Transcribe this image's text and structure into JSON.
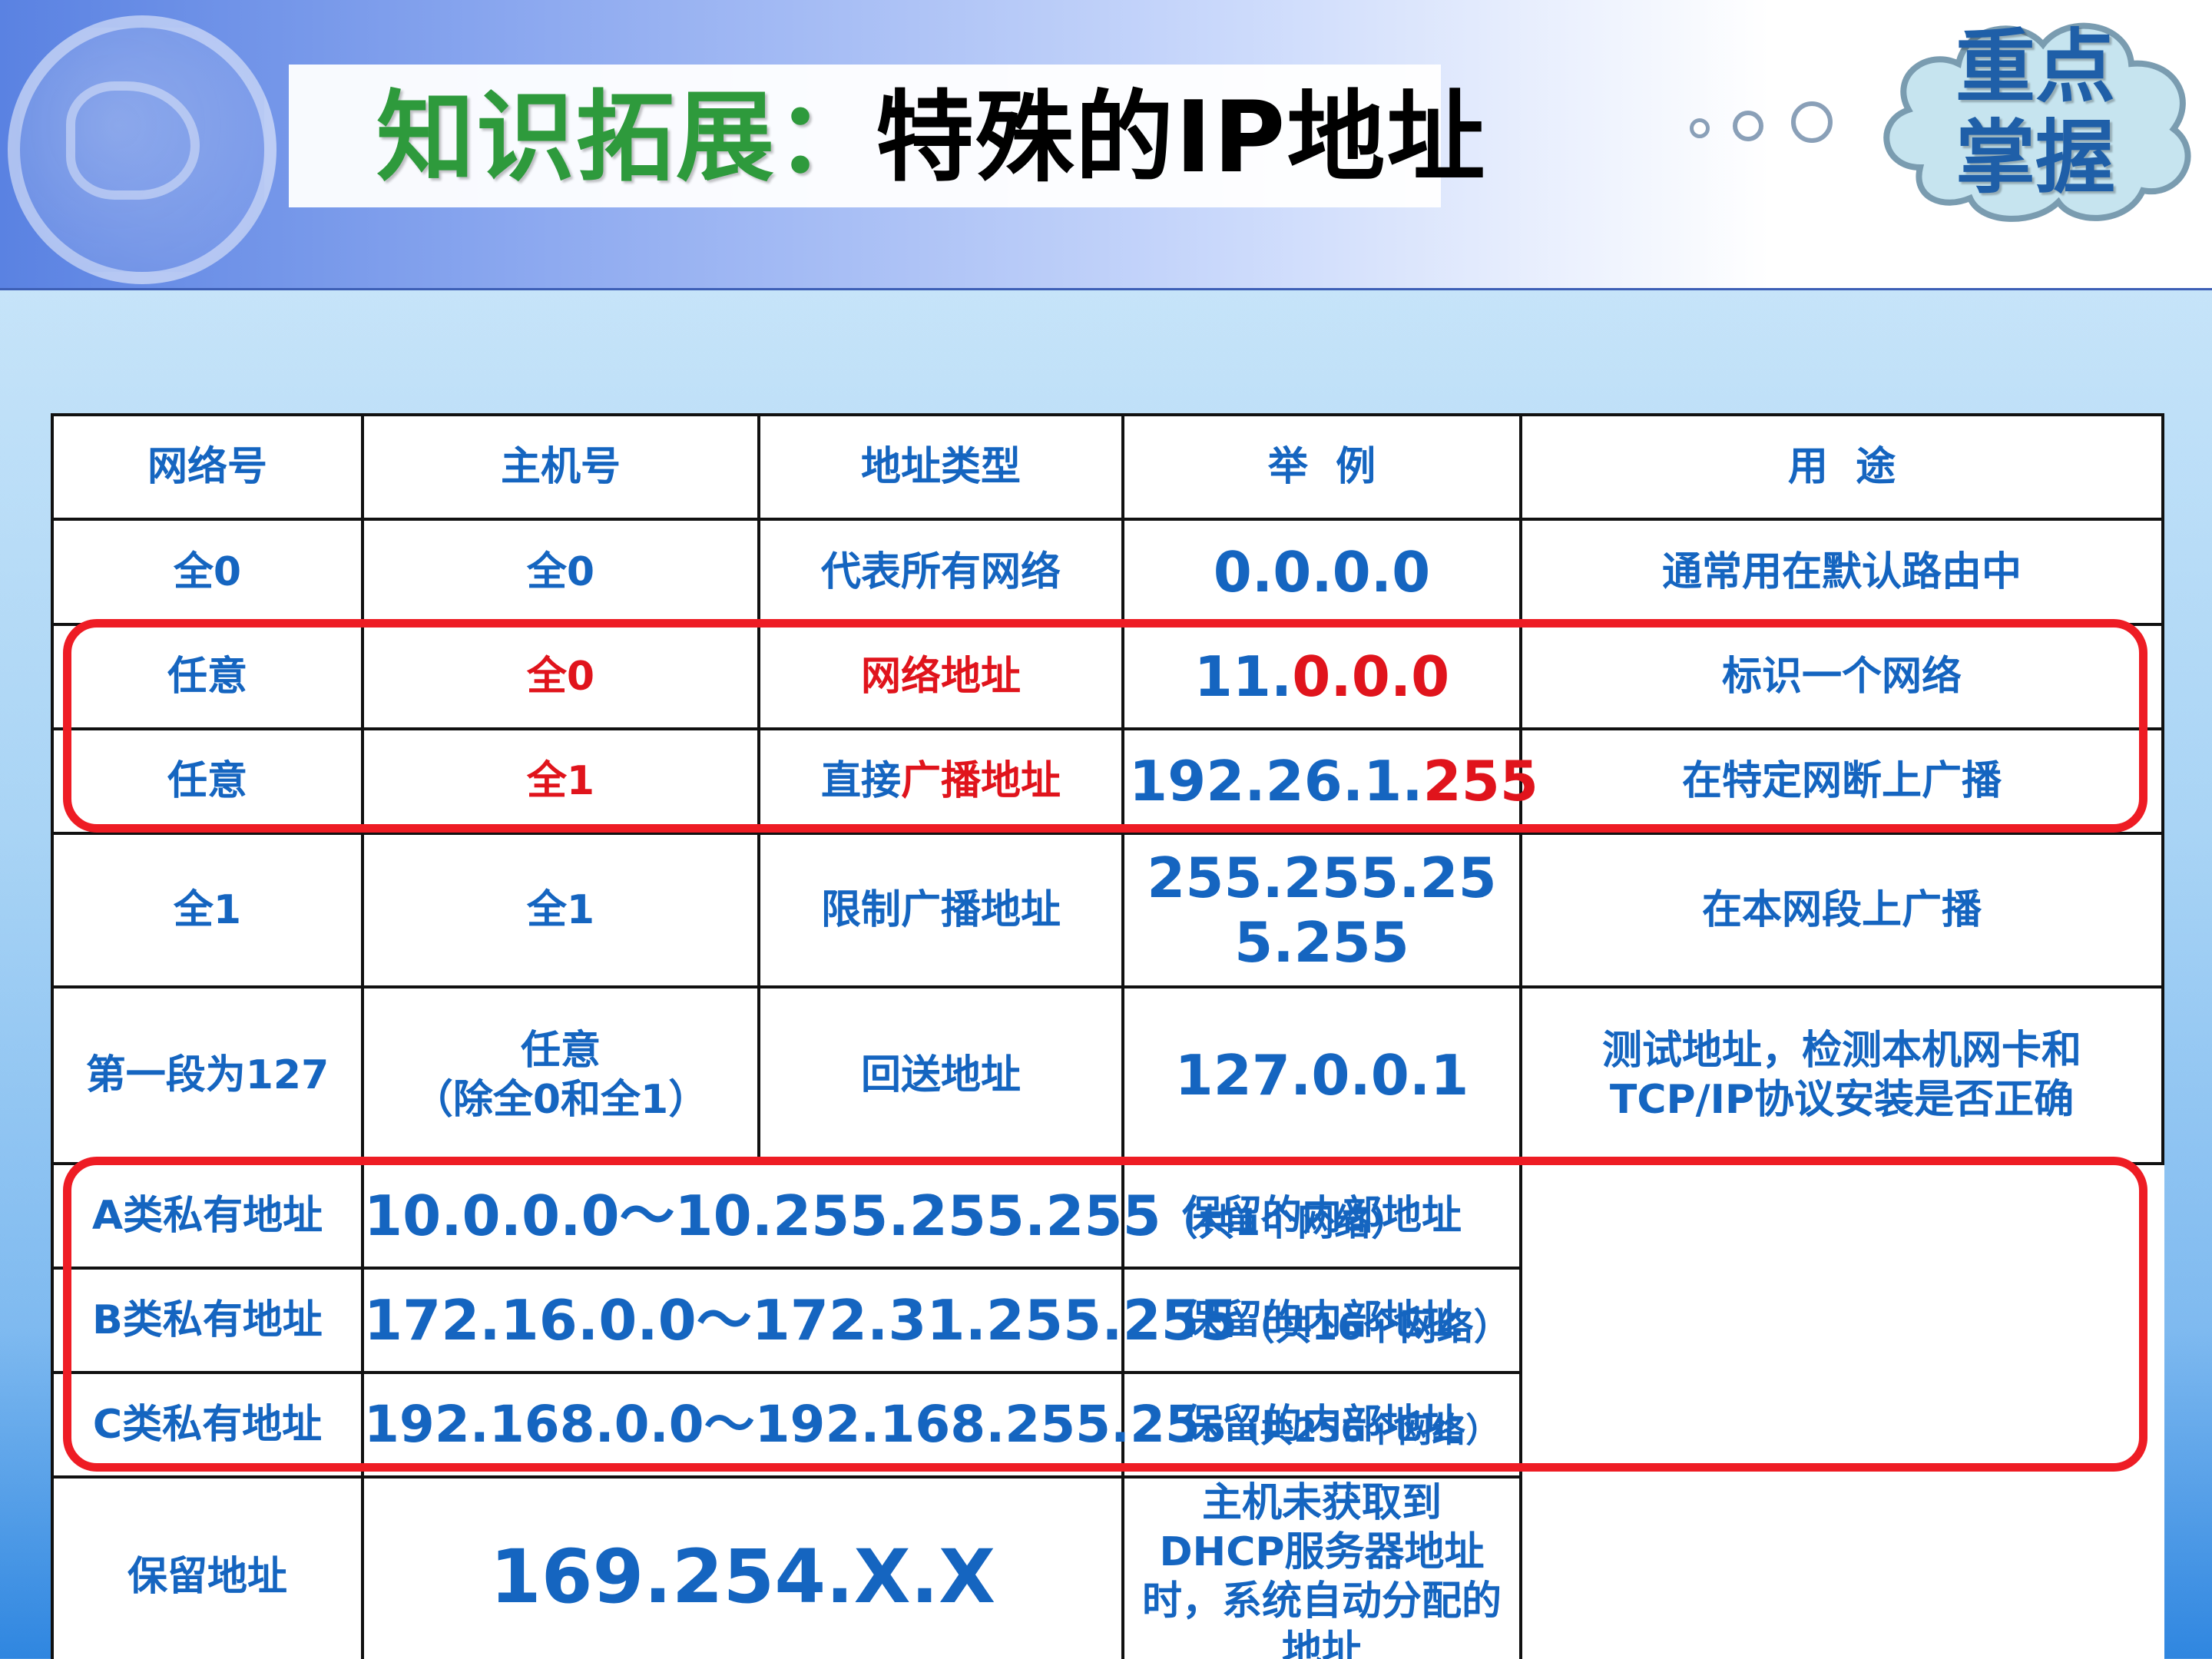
{
  "header": {
    "title_prefix": "知识拓展：",
    "title_main": "特殊的IP地址",
    "badge_line1": "重点",
    "badge_line2": "掌握"
  },
  "table": {
    "headers": [
      "网络号",
      "主机号",
      "地址类型",
      "举  例",
      "用  途"
    ],
    "row1": {
      "net": "全0",
      "host": "全0",
      "type": "代表所有网络",
      "example": "0.0.0.0",
      "use": "通常用在默认路由中"
    },
    "row2": {
      "net": "任意",
      "host": "全0",
      "type": "网络地址",
      "example_a": "11.",
      "example_b": "0.0.0",
      "use": "标识一个网络"
    },
    "row3": {
      "net": "任意",
      "host": "全1",
      "type_a": "直接",
      "type_b": "广播地址",
      "example_a": "192.26.1.",
      "example_b": "255",
      "use": "在特定网断上广播"
    },
    "row4": {
      "net": "全1",
      "host": "全1",
      "type": "限制广播地址",
      "example": "255.255.255.255",
      "use": "在本网段上广播"
    },
    "row5": {
      "net": "第一段为127",
      "host_a": "任意",
      "host_b": "（除全0和全1）",
      "type": "回送地址",
      "example": "127.0.0.1",
      "use": "测试地址，检测本机网卡和TCP/IP协议安装是否正确"
    },
    "row6": {
      "net": "A类私有地址",
      "range": "10.0.0.0～10.255.255.255",
      "note": "（共1个网络）",
      "use": "保留的内部地址"
    },
    "row7": {
      "net": "B类私有地址",
      "range": "172.16.0.0～172.31.255.255",
      "note": "（共16个网络）",
      "use": "保留的内部地址"
    },
    "row8": {
      "net": "C类私有地址",
      "range": "192.168.0.0～192.168.255.25",
      "range_tail": "5",
      "note": "（共256个网络）",
      "use": "保留的内部地址"
    },
    "row9": {
      "net": "保留地址",
      "range": "169.254.X.X",
      "use": "主机未获取到DHCP服务器地址时，系统自动分配的地址"
    }
  },
  "colors": {
    "text": "#1565c0",
    "highlight": "#e0141c",
    "title_green": "#2e9a3c"
  }
}
